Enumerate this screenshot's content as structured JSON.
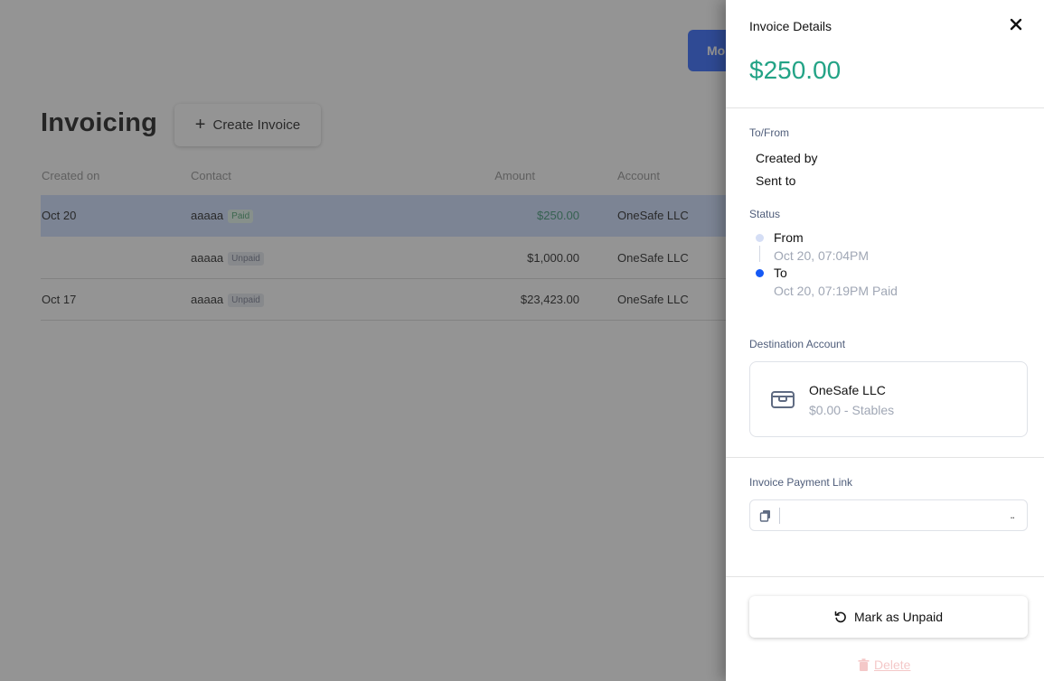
{
  "background": {
    "top_button_label": "Mo",
    "page_title": "Invoicing",
    "create_button_label": "Create Invoice",
    "table": {
      "headers": {
        "created_on": "Created on",
        "contact": "Contact",
        "amount": "Amount",
        "account": "Account"
      },
      "rows": [
        {
          "created_on": "Oct 20",
          "contact": "aaaaa",
          "status": "Paid",
          "amount": "$250.00",
          "account": "OneSafe LLC"
        },
        {
          "created_on": "",
          "contact": "aaaaa",
          "status": "Unpaid",
          "amount": "$1,000.00",
          "account": "OneSafe LLC"
        },
        {
          "created_on": "Oct 17",
          "contact": "aaaaa",
          "status": "Unpaid",
          "amount": "$23,423.00",
          "account": "OneSafe LLC"
        }
      ]
    }
  },
  "drawer": {
    "title": "Invoice Details",
    "amount": "$250.00",
    "to_from_label": "To/From",
    "created_by": "Created by",
    "sent_to": "Sent to",
    "status_label": "Status",
    "status_steps": [
      {
        "name": "From",
        "time": "Oct 20, 07:04PM"
      },
      {
        "name": "To",
        "time": "Oct 20, 07:19PM Paid"
      }
    ],
    "destination_label": "Destination Account",
    "destination": {
      "name": "OneSafe LLC",
      "sub": "$0.00 - Stables"
    },
    "payment_link_label": "Invoice Payment Link",
    "payment_link_value": "..",
    "mark_unpaid_label": "Mark as Unpaid",
    "delete_label": "Delete"
  },
  "colors": {
    "brand_blue": "#1f5bff",
    "paid_green": "#23a386",
    "selected_row": "#c9dbff",
    "status_dot_active": "#1559f5",
    "status_dot_inactive": "#d5def5"
  },
  "icons": {
    "close": "close-icon",
    "plus": "plus-icon",
    "wallet": "wallet-icon",
    "copy": "copy-icon",
    "undo": "undo-icon",
    "trash": "trash-icon"
  }
}
